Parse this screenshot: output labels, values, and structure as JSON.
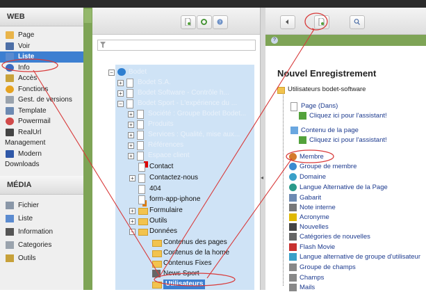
{
  "left_menu": {
    "web_title": "WEB",
    "web_items": [
      {
        "label": "Page",
        "icon": "page-edit-icon",
        "active": false
      },
      {
        "label": "Voir",
        "icon": "magnifier-icon",
        "active": false
      },
      {
        "label": "Liste",
        "icon": "list-icon",
        "active": true
      },
      {
        "label": "Info",
        "icon": "info-icon",
        "active": false
      },
      {
        "label": "Accès",
        "icon": "access-icon",
        "active": false
      },
      {
        "label": "Fonctions",
        "icon": "functions-icon",
        "active": false
      },
      {
        "label": "Gest. de versions",
        "icon": "versions-icon",
        "active": false
      },
      {
        "label": "Template",
        "icon": "template-icon",
        "active": false
      },
      {
        "label": "Powermail",
        "icon": "powermail-icon",
        "active": false
      },
      {
        "label": "RealUrl",
        "icon": "url-icon",
        "active": false
      },
      {
        "label": "Management",
        "icon": "",
        "active": false
      },
      {
        "label": "Modern",
        "icon": "modern-icon",
        "active": false
      },
      {
        "label": "Downloads",
        "icon": "",
        "active": false
      }
    ],
    "media_title": "MÉDIA",
    "media_items": [
      {
        "label": "Fichier",
        "icon": "file-icon"
      },
      {
        "label": "Liste",
        "icon": "list-icon"
      },
      {
        "label": "Information",
        "icon": "information-icon"
      },
      {
        "label": "Categories",
        "icon": "categories-icon"
      },
      {
        "label": "Outils",
        "icon": "tools-icon"
      }
    ]
  },
  "tree": {
    "filter_placeholder": "",
    "nodes": [
      {
        "label": "Bodet",
        "ghost": true,
        "toggle": "−"
      },
      {
        "label": "Bodet S.A.",
        "ghost": true,
        "toggle": "+"
      },
      {
        "label": "Bodet Software - Contrôle h...",
        "ghost": true,
        "toggle": "+"
      },
      {
        "label": "Bodet Sport - L'expérience du ...",
        "ghost": true,
        "toggle": "−"
      },
      {
        "label": "Société : Groupe Bodet Bodet...",
        "ghost": true,
        "toggle": "+"
      },
      {
        "label": "Produits",
        "ghost": true,
        "toggle": "+"
      },
      {
        "label": "Services : Qualité, mise aux...",
        "ghost": true,
        "toggle": "+"
      },
      {
        "label": "Références",
        "ghost": true,
        "toggle": "+"
      },
      {
        "label": "Espace client",
        "ghost": true,
        "toggle": "+"
      },
      {
        "label": "Contact",
        "ghost": false,
        "toggle": ""
      },
      {
        "label": "Contactez-nous",
        "ghost": false,
        "toggle": "+"
      },
      {
        "label": "404",
        "ghost": false,
        "toggle": ""
      },
      {
        "label": "form-app-iphone",
        "ghost": false,
        "toggle": ""
      },
      {
        "label": "Formulaire",
        "ghost": false,
        "toggle": "+"
      },
      {
        "label": "Outils",
        "ghost": false,
        "toggle": "+"
      },
      {
        "label": "Données",
        "ghost": false,
        "toggle": "−"
      },
      {
        "label": "Contenus des pages",
        "ghost": false,
        "toggle": ""
      },
      {
        "label": "Contenus de la home",
        "ghost": false,
        "toggle": ""
      },
      {
        "label": "Contenus Fixes",
        "ghost": false,
        "toggle": ""
      },
      {
        "label": "News Sport",
        "ghost": false,
        "toggle": ""
      },
      {
        "label": "Utilisateurs",
        "ghost": false,
        "toggle": "",
        "highlight": true
      }
    ]
  },
  "right": {
    "title": "Nouvel Enregistrement",
    "folder_label": "Utilisateurs bodet-software",
    "items": [
      {
        "label": "Page (Dans)",
        "icon": "page-icon"
      },
      {
        "label": "Cliquez ici pour l'assistant!",
        "icon": "wizard-icon"
      },
      {
        "label": "Contenu de la page",
        "icon": "content-icon"
      },
      {
        "label": "Cliquez ici pour l'assistant!",
        "icon": "wizard-icon"
      },
      {
        "label": "Membre",
        "icon": "member-icon"
      },
      {
        "label": "Groupe de membre",
        "icon": "member-group-icon"
      },
      {
        "label": "Domaine",
        "icon": "domain-icon"
      },
      {
        "label": "Langue Alternative de la Page",
        "icon": "language-icon"
      },
      {
        "label": "Gabarit",
        "icon": "template-icon"
      },
      {
        "label": "Note interne",
        "icon": "note-icon"
      },
      {
        "label": "Acronyme",
        "icon": "acronym-icon"
      },
      {
        "label": "Nouvelles",
        "icon": "news-icon"
      },
      {
        "label": "Catégories de nouvelles",
        "icon": "news-categories-icon"
      },
      {
        "label": "Flash Movie",
        "icon": "flash-icon"
      },
      {
        "label": "Langue alternative de groupe d'utilisateur",
        "icon": "language-group-icon"
      },
      {
        "label": "Groupe de champs",
        "icon": "field-group-icon"
      },
      {
        "label": "Champs",
        "icon": "fields-icon"
      },
      {
        "label": "Mails",
        "icon": "mails-icon"
      }
    ]
  },
  "colors": {
    "accent": "#3d7fd1",
    "annotation": "#d83a3a",
    "green_header": "#7ea456",
    "tree_selection": "#cfe3f6"
  }
}
